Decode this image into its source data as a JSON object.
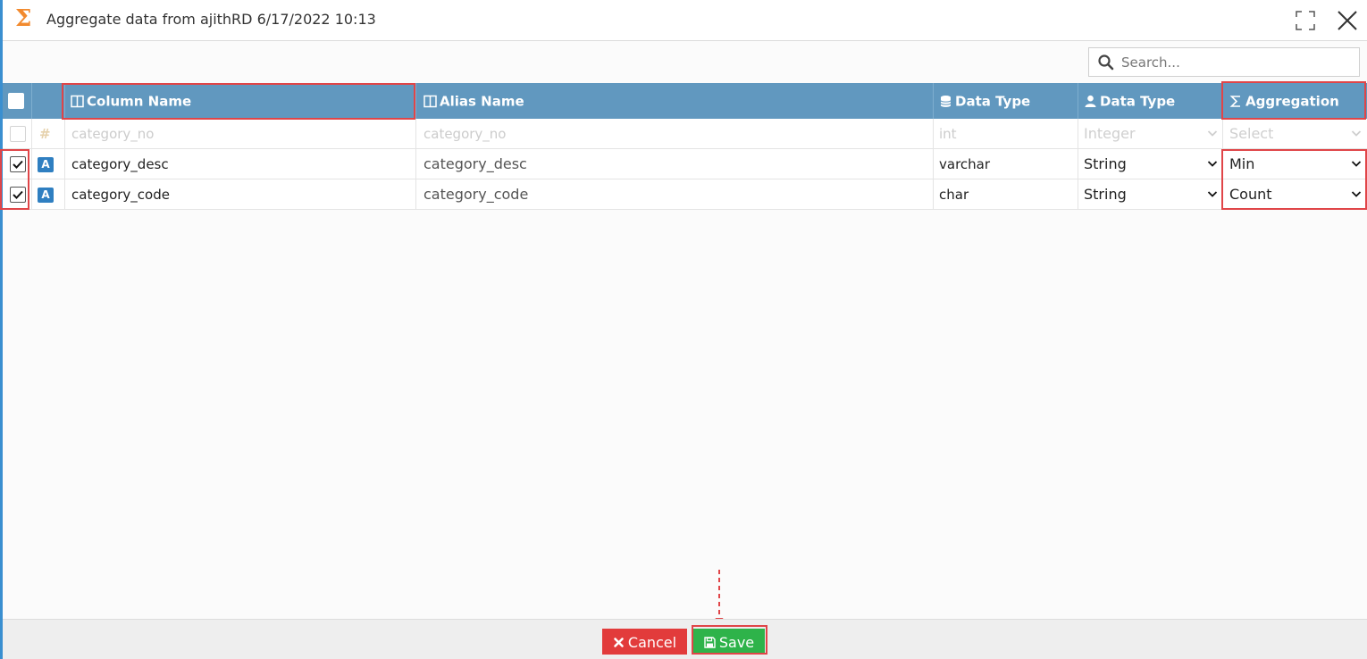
{
  "dialog": {
    "title": "Aggregate data from ajithRD 6/17/2022 10:13",
    "sigma_glyph": "Σ"
  },
  "search": {
    "placeholder": "Search..."
  },
  "columns": {
    "column_name": "Column Name",
    "alias_name": "Alias Name",
    "db_datatype": "Data Type",
    "datatype": "Data Type",
    "aggregation": "Aggregation"
  },
  "rows": [
    {
      "checked": false,
      "type_icon": "#",
      "column_name": "category_no",
      "alias_name": "category_no",
      "db_datatype": "int",
      "datatype": "Integer",
      "aggregation": "Select",
      "disabled": true
    },
    {
      "checked": true,
      "type_icon": "A",
      "column_name": "category_desc",
      "alias_name": "category_desc",
      "db_datatype": "varchar",
      "datatype": "String",
      "aggregation": "Min",
      "disabled": false
    },
    {
      "checked": true,
      "type_icon": "A",
      "column_name": "category_code",
      "alias_name": "category_code",
      "db_datatype": "char",
      "datatype": "String",
      "aggregation": "Count",
      "disabled": false
    }
  ],
  "footer": {
    "cancel_label": "Cancel",
    "save_label": "Save"
  },
  "colors": {
    "header_bg": "#6198bf",
    "accent_orange": "#f28a2e",
    "cancel_red": "#e23b3b",
    "save_green": "#2eb34a",
    "highlight_red": "#e04548"
  }
}
